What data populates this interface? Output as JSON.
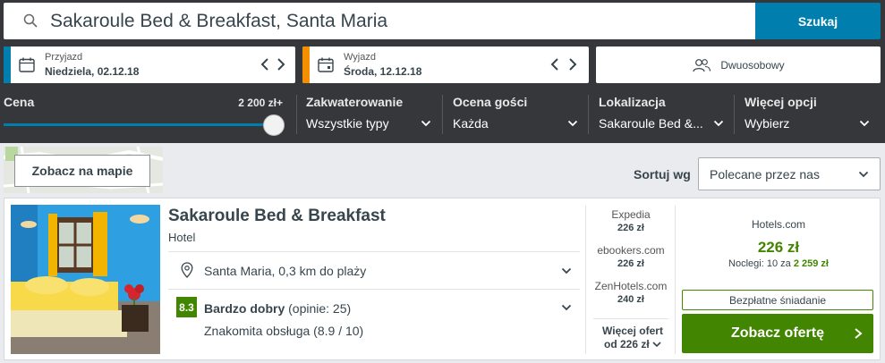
{
  "search": {
    "query": "Sakaroule Bed & Breakfast, Santa Maria",
    "button_label": "Szukaj"
  },
  "dates": {
    "checkin": {
      "label": "Przyjazd",
      "value": "Niedziela, 02.12.18",
      "accent": "#007faf"
    },
    "checkout": {
      "label": "Wyjazd",
      "value": "Środa, 12.12.18",
      "accent": "#f48f00"
    }
  },
  "room": {
    "label": "Dwuosobowy"
  },
  "filters": {
    "price": {
      "title": "Cena",
      "max_value": "2 200 zł+",
      "slider_level": 1.0
    },
    "accommodation": {
      "title": "Zakwaterowanie",
      "value": "Wszystkie typy"
    },
    "guest_rating": {
      "title": "Ocena gości",
      "value": "Każda"
    },
    "location": {
      "title": "Lokalizacja",
      "value": "Sakaroule Bed &..."
    },
    "more": {
      "title": "Więcej opcji",
      "value": "Wybierz"
    }
  },
  "map_button": {
    "label": "Zobacz na mapie"
  },
  "sort": {
    "label": "Sortuj wg",
    "value": "Polecane przez nas"
  },
  "result": {
    "name": "Sakaroule Bed & Breakfast",
    "type": "Hotel",
    "location": "Santa Maria, 0,3 km do plaży",
    "rating": {
      "score": "8.3",
      "label": "Bardzo dobry",
      "reviews": "(opinie: 25)",
      "sub": "Znakomita obsługa (8.9 / 10)",
      "color": "#428500"
    },
    "providers": [
      {
        "name": "Expedia",
        "price": "226 zł"
      },
      {
        "name": "ebookers.com",
        "price": "226 zł"
      },
      {
        "name": "ZenHotels.com",
        "price": "240 zł"
      }
    ],
    "more_offers": {
      "line1": "Więcej ofert",
      "line2": "od 226 zł"
    },
    "best": {
      "site": "Hotels.com",
      "price": "226 zł",
      "nights_prefix": "Noclegi: 10 za",
      "nights_total": "2 259 zł",
      "perk": "Bezpłatne śniadanie",
      "cta": "Zobacz ofertę"
    }
  }
}
